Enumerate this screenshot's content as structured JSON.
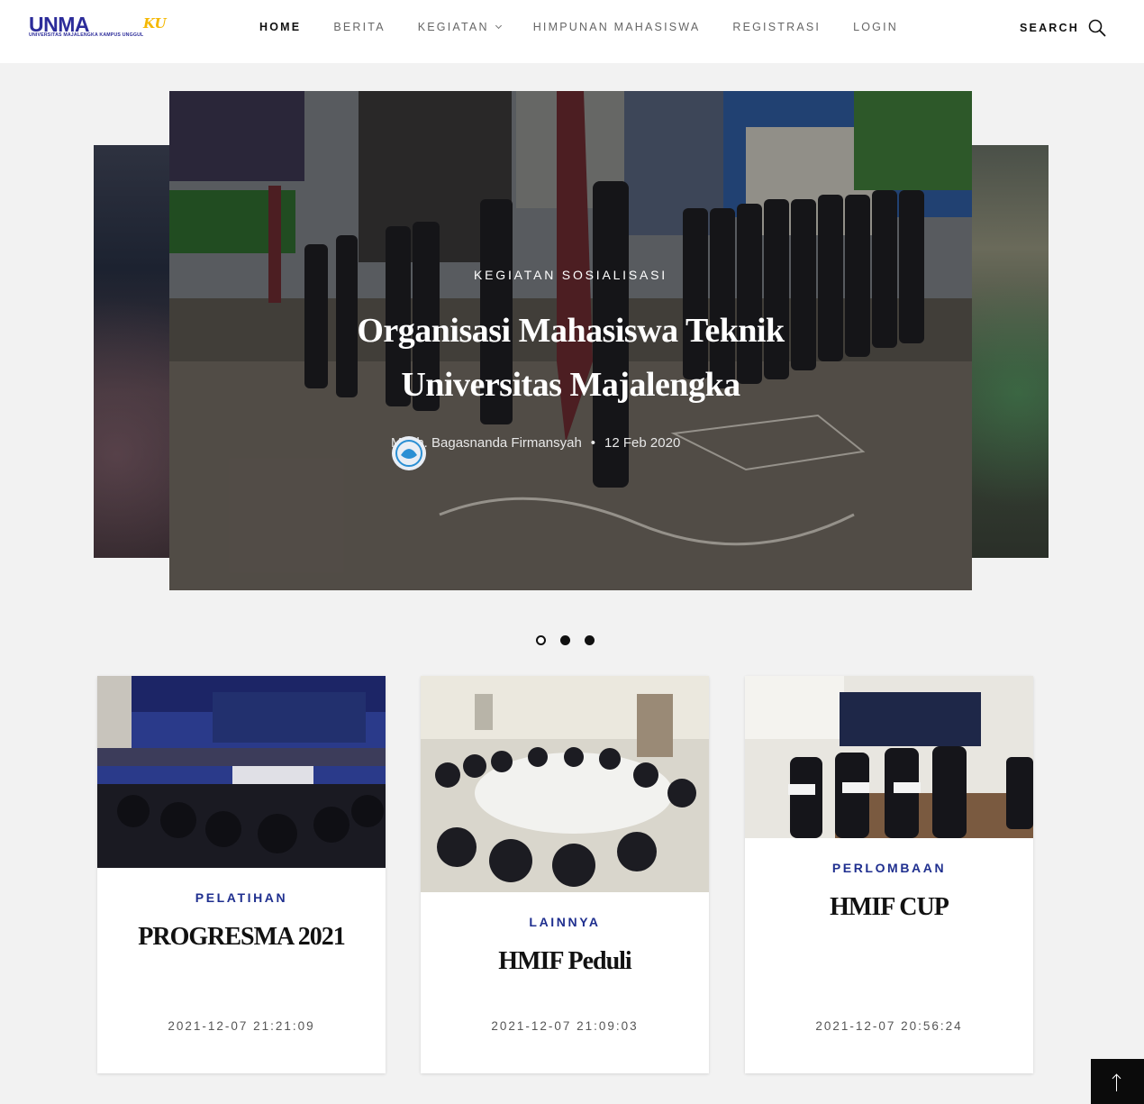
{
  "header": {
    "logo_text": "UNMA",
    "logo_suffix": "KU",
    "logo_subtitle": "UNIVERSITAS MAJALENGKA KAMPUS UNGGUL",
    "nav": [
      {
        "label": "HOME"
      },
      {
        "label": "BERITA"
      },
      {
        "label": "KEGIATAN"
      },
      {
        "label": "HIMPUNAN MAHASISWA"
      },
      {
        "label": "REGISTRASI"
      },
      {
        "label": "LOGIN"
      }
    ],
    "search_label": "SEARCH"
  },
  "slider": {
    "category": "KEGIATAN SOSIALISASI",
    "title": "Organisasi Mahasiswa Teknik Universitas Majalengka",
    "author": "Moch. Bagasnanda Firmansyah",
    "date": "12 Feb 2020",
    "active_dot": 1,
    "dot_count": 3
  },
  "cards": [
    {
      "category": "PELATIHAN",
      "title": "PROGRESMA 2021",
      "datetime": "2021-12-07 21:21:09"
    },
    {
      "category": "LAINNYA",
      "title": "HMIF Peduli",
      "datetime": "2021-12-07 21:09:03"
    },
    {
      "category": "PERLOMBAAN",
      "title": "HMIF CUP",
      "datetime": "2021-12-07 20:56:24"
    }
  ],
  "colors": {
    "accent": "#1f2f8f",
    "logo_blue": "#2c2c9a",
    "logo_yellow": "#f5b800",
    "background": "#f2f2f2"
  },
  "icons": {
    "search": "search-icon",
    "scroll_top": "arrow-up-icon",
    "dropdown": "chevron-down-icon"
  }
}
